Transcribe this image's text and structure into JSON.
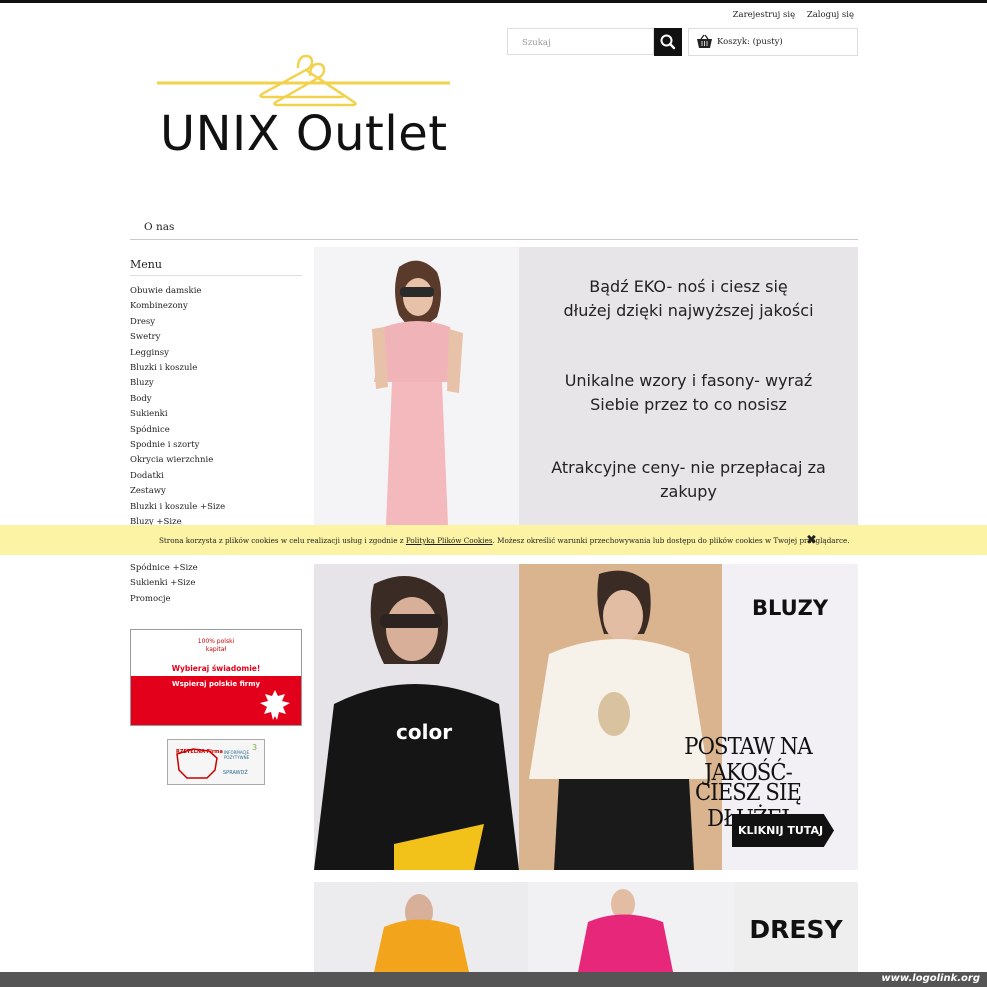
{
  "header": {
    "register": "Zarejestruj się",
    "login": "Zaloguj się",
    "search_placeholder": "Szukaj",
    "cart_label": "Koszyk: (pusty)",
    "logo_text": "UNIX Outlet"
  },
  "nav": {
    "items": [
      "O nas"
    ]
  },
  "sidebar": {
    "title": "Menu",
    "items": [
      "Obuwie damskie",
      "Kombinezony",
      "Dresy",
      "Swetry",
      "Legginsy",
      "Bluzki i koszule",
      "Bluzy",
      "Body",
      "Sukienki",
      "Spódnice",
      "Spodnie i szorty",
      "Okrycia wierzchnie",
      "Dodatki",
      "Zestawy",
      "Bluzki i koszule +Size",
      "Bluzy +Size"
    ],
    "items_after": [
      "Spódnice +Size",
      "Sukienki +Size",
      "Promocje"
    ]
  },
  "banner_pl": {
    "line1": "100% polski",
    "line2": "kapitał",
    "line3": "Wybieraj świadomie!",
    "line4": "Wspieraj polskie firmy"
  },
  "rzetelna": {
    "title": "RZETELNA Firma",
    "info": "INFORMACJE POZYTYWNE",
    "check": "SPRAWDŹ",
    "num": "3"
  },
  "hero": {
    "line1": "Bądź EKO- noś i ciesz się",
    "line2": "dłużej dzięki najwyższej jakości",
    "line3": "Unikalne wzory i fasony- wyraź",
    "line4": "Siebie przez to co nosisz",
    "line5": "Atrakcyjne ceny- nie przepłacaj za",
    "line6": "zakupy"
  },
  "cookie": {
    "text_before": "Strona korzysta z plików cookies w celu realizacji usług i zgodnie z ",
    "link": "Polityką Plików Cookies",
    "text_after": ". Możesz określić warunki przechowywania lub dostępu do plików cookies w Twojej przeglądarce.",
    "close": "✖"
  },
  "bluzy": {
    "title": "BLUZY",
    "shirt_text": "color",
    "slogan1": "POSTAW NA JAKOŚĆ-",
    "slogan2": "CIESZ SIĘ DŁUŻEJ",
    "cta": "KLIKNIJ TUTAJ"
  },
  "dresy": {
    "title": "DRESY"
  },
  "footer": {
    "link": "www.logolink.org"
  }
}
